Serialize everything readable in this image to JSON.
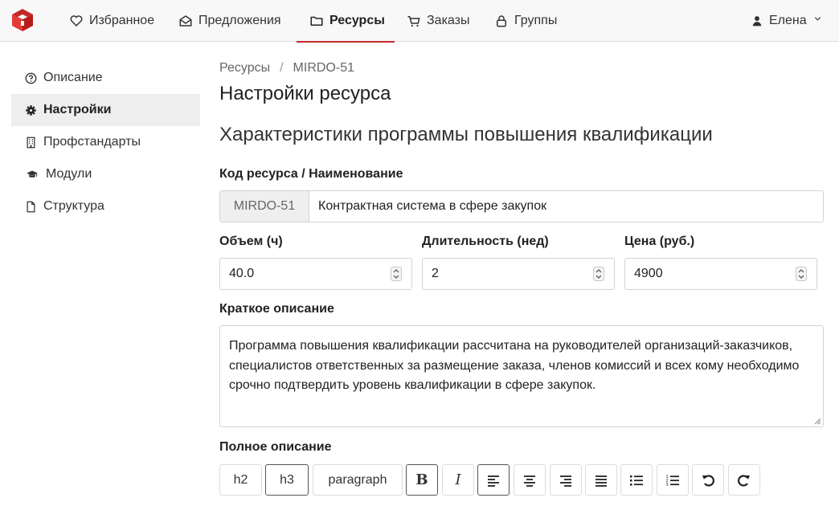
{
  "nav": {
    "items": [
      {
        "label": "Избранное",
        "icon": "heart-icon"
      },
      {
        "label": "Предложения",
        "icon": "envelope-open-icon"
      },
      {
        "label": "Ресурсы",
        "icon": "folder-icon"
      },
      {
        "label": "Заказы",
        "icon": "cart-icon"
      },
      {
        "label": "Группы",
        "icon": "lock-icon"
      }
    ],
    "active": "Ресурсы",
    "user_name": "Елена",
    "accent_color": "#c62828"
  },
  "sidebar": {
    "items": [
      {
        "label": "Описание",
        "icon": "question-circle-icon"
      },
      {
        "label": "Настройки",
        "icon": "gear-icon"
      },
      {
        "label": "Профстандарты",
        "icon": "building-icon"
      },
      {
        "label": "Модули",
        "icon": "graduation-cap-icon"
      },
      {
        "label": "Структура",
        "icon": "file-icon"
      }
    ],
    "active": "Настройки"
  },
  "breadcrumb": {
    "root": "Ресурсы",
    "separator": "/",
    "current": "MIRDO-51"
  },
  "page_title": "Настройки ресурса",
  "section_title": "Характеристики программы повышения квалификации",
  "form": {
    "code_name_label": "Код ресурса / Наименование",
    "code": "MIRDO-51",
    "name": "Контрактная система в сфере закупок",
    "volume_label": "Объем (ч)",
    "volume": "40.0",
    "duration_label": "Длительность (нед)",
    "duration": "2",
    "price_label": "Цена (руб.)",
    "price": "4900",
    "short_desc_label": "Краткое описание",
    "short_desc": "Программа повышения квалификации рассчитана на руководителей организаций-заказчиков, специалистов ответственных за размещение заказа, членов комиссий и всех кому необходимо срочно подтвердить уровень квалификации в сфере закупок.",
    "full_desc_label": "Полное описание"
  },
  "toolbar": {
    "h2": "h2",
    "h3": "h3",
    "paragraph": "paragraph",
    "bold": "B",
    "italic": "I"
  }
}
